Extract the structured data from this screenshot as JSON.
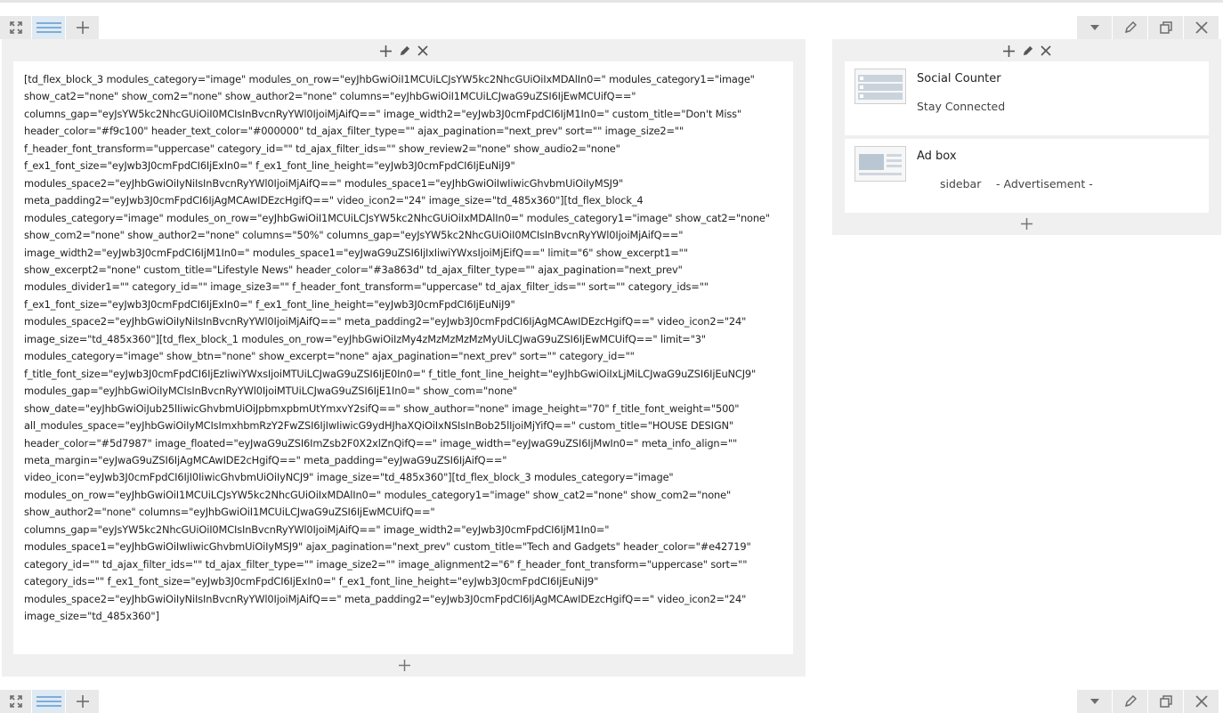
{
  "icons": {
    "expand": "expand-icon",
    "layout": "layout-icon",
    "add": "plus-icon",
    "dropdown": "caret-down-icon",
    "edit": "pencil-icon",
    "clone": "clone-icon",
    "delete": "close-icon"
  },
  "main_column": {
    "shortcode": "[td_flex_block_3 modules_category=\"image\" modules_on_row=\"eyJhbGwiOiI1MCUiLCJsYW5kc2NhcGUiOiIxMDAlIn0=\" modules_category1=\"image\" show_cat2=\"none\" show_com2=\"none\" show_author2=\"none\" columns=\"eyJhbGwiOiI1MCUiLCJwaG9uZSI6IjEwMCUifQ==\" columns_gap=\"eyJsYW5kc2NhcGUiOiI0MCIsInBvcnRyYWl0IjoiMjAifQ==\" image_width2=\"eyJwb3J0cmFpdCI6IjM1In0=\" custom_title=\"Don't Miss\" header_color=\"#f9c100\" header_text_color=\"#000000\" td_ajax_filter_type=\"\" ajax_pagination=\"next_prev\" sort=\"\" image_size2=\"\" f_header_font_transform=\"uppercase\" category_id=\"\" td_ajax_filter_ids=\"\" show_review2=\"none\" show_audio2=\"none\" f_ex1_font_size=\"eyJwb3J0cmFpdCI6IjExIn0=\" f_ex1_font_line_height=\"eyJwb3J0cmFpdCI6IjEuNiJ9\" modules_space2=\"eyJhbGwiOiIyNiIsInBvcnRyYWl0IjoiMjAifQ==\" modules_space1=\"eyJhbGwiOiIwIiwicGhvbmUiOiIyMSJ9\" meta_padding2=\"eyJwb3J0cmFpdCI6IjAgMCAwIDEzcHgifQ==\" video_icon2=\"24\" image_size=\"td_485x360\"][td_flex_block_4 modules_category=\"image\" modules_on_row=\"eyJhbGwiOiI1MCUiLCJsYW5kc2NhcGUiOiIxMDAlIn0=\" modules_category1=\"image\" show_cat2=\"none\" show_com2=\"none\" show_author2=\"none\" columns=\"50%\" columns_gap=\"eyJsYW5kc2NhcGUiOiI0MCIsInBvcnRyYWl0IjoiMjAifQ==\" image_width2=\"eyJwb3J0cmFpdCI6IjM1In0=\" modules_space1=\"eyJwaG9uZSI6IjIxIiwiYWxsIjoiMjEifQ==\" limit=\"6\" show_excerpt1=\"\" show_excerpt2=\"none\" custom_title=\"Lifestyle News\" header_color=\"#3a863d\" td_ajax_filter_type=\"\" ajax_pagination=\"next_prev\" modules_divider1=\"\" category_id=\"\" image_size3=\"\" f_header_font_transform=\"uppercase\" td_ajax_filter_ids=\"\" sort=\"\" category_ids=\"\" f_ex1_font_size=\"eyJwb3J0cmFpdCI6IjExIn0=\" f_ex1_font_line_height=\"eyJwb3J0cmFpdCI6IjEuNiJ9\" modules_space2=\"eyJhbGwiOiIyNiIsInBvcnRyYWl0IjoiMjAifQ==\" meta_padding2=\"eyJwb3J0cmFpdCI6IjAgMCAwIDEzcHgifQ==\" video_icon2=\"24\" image_size=\"td_485x360\"][td_flex_block_1 modules_on_row=\"eyJhbGwiOiIzMy4zMzMzMzMzMyUiLCJwaG9uZSI6IjEwMCUifQ==\" limit=\"3\" modules_category=\"image\" show_btn=\"none\" show_excerpt=\"none\" ajax_pagination=\"next_prev\" sort=\"\" category_id=\"\" f_title_font_size=\"eyJwb3J0cmFpdCI6IjEzIiwiYWxsIjoiMTUiLCJwaG9uZSI6IjE0In0=\" f_title_font_line_height=\"eyJhbGwiOiIxLjMiLCJwaG9uZSI6IjEuNCJ9\" modules_gap=\"eyJhbGwiOiIyMCIsInBvcnRyYWl0IjoiMTUiLCJwaG9uZSI6IjE1In0=\" show_com=\"none\" show_date=\"eyJhbGwiOiJub25lIiwicGhvbmUiOiJpbmxpbmUtYmxvY2sifQ==\" show_author=\"none\" image_height=\"70\" f_title_font_weight=\"500\" all_modules_space=\"eyJhbGwiOiIyMCIsImxhbmRzY2FwZSI6IjIwIiwicG9ydHJhaXQiOiIxNSIsInBob25lIjoiMjYifQ==\" custom_title=\"HOUSE DESIGN\" header_color=\"#5d7987\" image_floated=\"eyJwaG9uZSI6ImZsb2F0X2xlZnQifQ==\" image_width=\"eyJwaG9uZSI6IjMwIn0=\" meta_info_align=\"\" meta_margin=\"eyJwaG9uZSI6IjAgMCAwIDE2cHgifQ==\" meta_padding=\"eyJwaG9uZSI6IjAifQ==\" video_icon=\"eyJwb3J0cmFpdCI6IjI0IiwicGhvbmUiOiIyNCJ9\" image_size=\"td_485x360\"][td_flex_block_3 modules_category=\"image\" modules_on_row=\"eyJhbGwiOiI1MCUiLCJsYW5kc2NhcGUiOiIxMDAlIn0=\" modules_category1=\"image\" show_cat2=\"none\" show_com2=\"none\" show_author2=\"none\" columns=\"eyJhbGwiOiI1MCUiLCJwaG9uZSI6IjEwMCUifQ==\" columns_gap=\"eyJsYW5kc2NhcGUiOiI0MCIsInBvcnRyYWl0IjoiMjAifQ==\" image_width2=\"eyJwb3J0cmFpdCI6IjM1In0=\" modules_space1=\"eyJhbGwiOiIwIiwicGhvbmUiOiIyMSJ9\" ajax_pagination=\"next_prev\" custom_title=\"Tech and Gadgets\" header_color=\"#e42719\" category_id=\"\" td_ajax_filter_ids=\"\" td_ajax_filter_type=\"\" image_size2=\"\" image_alignment2=\"6\" f_header_font_transform=\"uppercase\" sort=\"\" category_ids=\"\" f_ex1_font_size=\"eyJwb3J0cmFpdCI6IjExIn0=\" f_ex1_font_line_height=\"eyJwb3J0cmFpdCI6IjEuNiJ9\" modules_space2=\"eyJhbGwiOiIyNiIsInBvcnRyYWl0IjoiMjAifQ==\" meta_padding2=\"eyJwb3J0cmFpdCI6IjAgMCAwIDEzcHgifQ==\" video_icon2=\"24\" image_size=\"td_485x360\"]"
  },
  "sidebar": {
    "widgets": [
      {
        "title": "Social Counter",
        "subtitle": "Stay Connected"
      },
      {
        "title": "Ad box",
        "subtitle": "sidebar",
        "subtitle2": "- Advertisement -"
      }
    ]
  },
  "colors": {
    "background": "#ffffff",
    "column_bg": "#f0f0f0",
    "toolbar_btn": "#e9e9e9",
    "toolbar_active": "#dfe9f2",
    "layout_icon": "#5b9bd5",
    "icon_gray": "#6d6d6d"
  }
}
